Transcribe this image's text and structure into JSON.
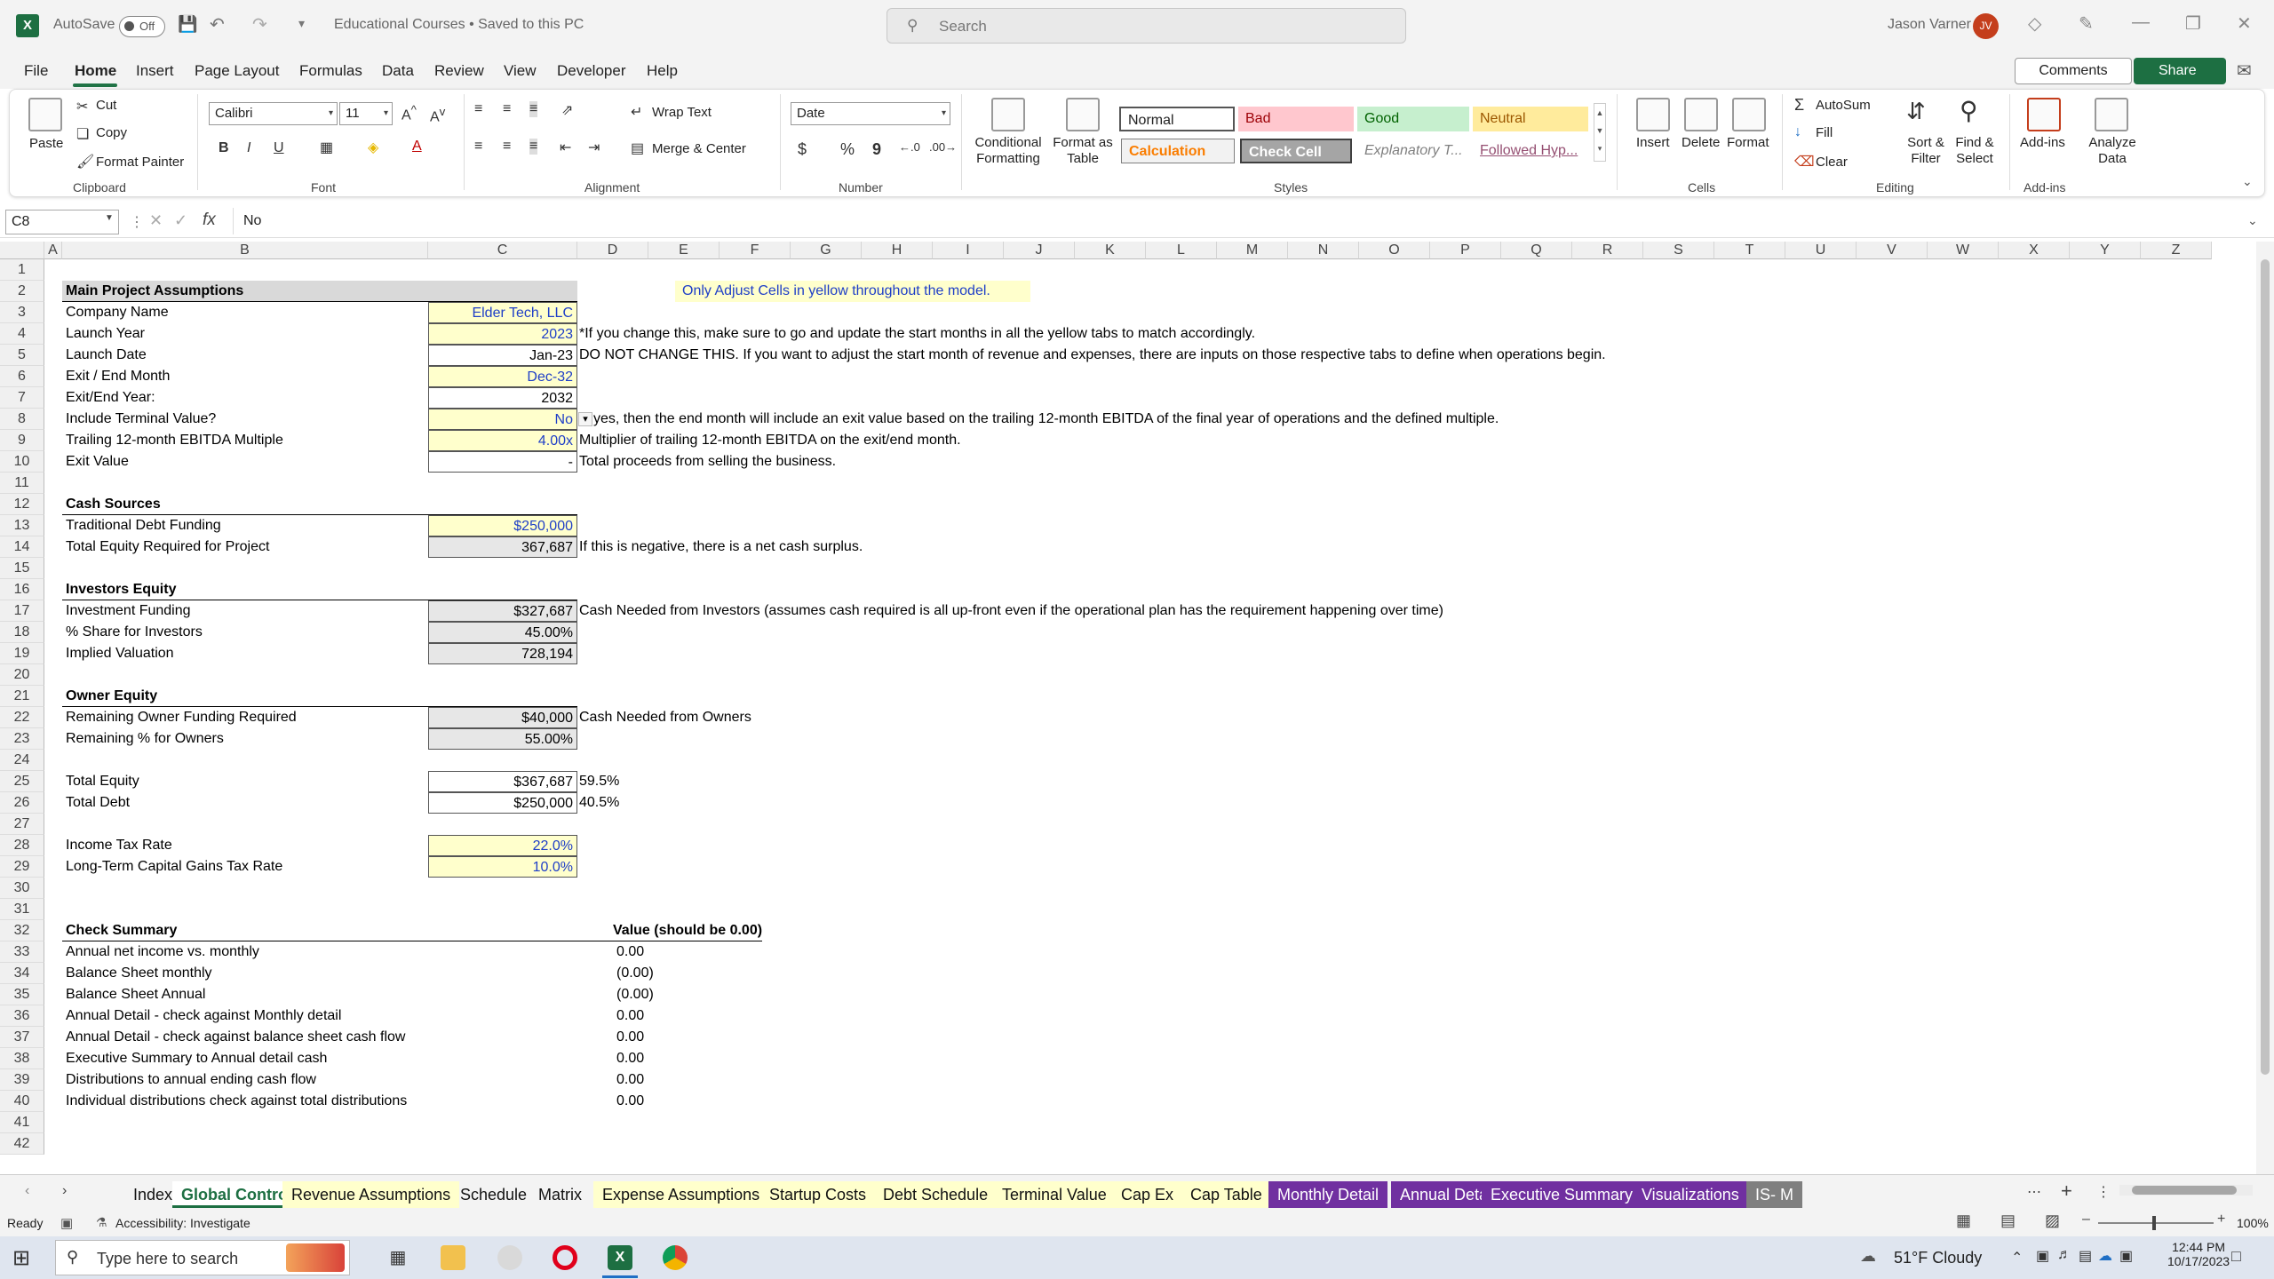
{
  "titlebar": {
    "app_icon": "excel-icon",
    "autosave_label": "AutoSave",
    "autosave_state": "Off",
    "doc_title": "Educational Courses • Saved to this PC",
    "search_placeholder": "Search",
    "user_name": "Jason Varner",
    "user_initials": "JV"
  },
  "menu": {
    "tabs": [
      "File",
      "Home",
      "Insert",
      "Page Layout",
      "Formulas",
      "Data",
      "Review",
      "View",
      "Developer",
      "Help"
    ],
    "active": "Home",
    "comments_label": "Comments",
    "share_label": "Share"
  },
  "ribbon": {
    "clipboard": {
      "paste": "Paste",
      "cut": "Cut",
      "copy": "Copy",
      "format_painter": "Format Painter",
      "label": "Clipboard"
    },
    "font": {
      "name": "Calibri",
      "size": "11",
      "label": "Font",
      "bold": "B",
      "italic": "I",
      "underline": "U"
    },
    "alignment": {
      "wrap_text": "Wrap Text",
      "merge_center": "Merge & Center",
      "label": "Alignment"
    },
    "number": {
      "format": "Date",
      "label": "Number",
      "currency": "$",
      "percent": "%",
      "comma": "9"
    },
    "styles": {
      "conditional_formatting": "Conditional Formatting",
      "format_as_table": "Format as Table",
      "cells": [
        {
          "text": "Normal",
          "bg": "#ffffff",
          "fg": "#000000"
        },
        {
          "text": "Bad",
          "bg": "#ffc7ce",
          "fg": "#9c0006"
        },
        {
          "text": "Good",
          "bg": "#c6efce",
          "fg": "#006100"
        },
        {
          "text": "Neutral",
          "bg": "#ffeb9c",
          "fg": "#9c5700"
        },
        {
          "text": "Calculation",
          "bg": "#f2f2f2",
          "fg": "#fa7d00"
        },
        {
          "text": "Check Cell",
          "bg": "#a5a5a5",
          "fg": "#ffffff"
        },
        {
          "text": "Explanatory T...",
          "bg": "#ffffff",
          "fg": "#7f7f7f"
        },
        {
          "text": "Followed Hyp...",
          "bg": "#ffffff",
          "fg": "#954f72"
        }
      ],
      "label": "Styles"
    },
    "cells": {
      "insert": "Insert",
      "delete": "Delete",
      "format": "Format",
      "label": "Cells"
    },
    "editing": {
      "autosum": "AutoSum",
      "fill": "Fill",
      "clear": "Clear",
      "sort_filter": "Sort & Filter",
      "find_select": "Find & Select",
      "label": "Editing"
    },
    "addins": {
      "addins": "Add-ins",
      "analyze": "Analyze Data",
      "label": "Add-ins"
    }
  },
  "formula_bar": {
    "name_box": "C8",
    "fx": "fx",
    "value": "No"
  },
  "columns": [
    "A",
    "B",
    "C",
    "D",
    "E",
    "F",
    "G",
    "H",
    "I",
    "J",
    "K",
    "L",
    "M",
    "N",
    "O",
    "P",
    "Q",
    "R",
    "S",
    "T",
    "U",
    "V",
    "W",
    "X",
    "Y",
    "Z"
  ],
  "rows": [
    1,
    2,
    3,
    4,
    5,
    6,
    7,
    8,
    9,
    10,
    11,
    12,
    13,
    14,
    15,
    16,
    17,
    18,
    19,
    20,
    21,
    22,
    23,
    24,
    25,
    26,
    27,
    28,
    29,
    30,
    31,
    32,
    33,
    34,
    35,
    36,
    37,
    38,
    39,
    40,
    41,
    42
  ],
  "sheet": {
    "banner": "Only Adjust Cells in yellow throughout the model.",
    "main": {
      "title": "Main Project Assumptions",
      "rows": [
        {
          "label": "Company Name",
          "value": "Elder Tech, LLC",
          "note": ""
        },
        {
          "label": "Launch Year",
          "value": "2023",
          "note": "*If you change this, make sure to go and update the start months in all the yellow tabs to match accordingly."
        },
        {
          "label": "Launch Date",
          "value": "Jan-23",
          "note": "DO NOT CHANGE THIS. If you want to adjust the start month of revenue and expenses, there are inputs on those respective tabs to define when operations begin."
        },
        {
          "label": "Exit / End Month",
          "value": "Dec-32",
          "note": ""
        },
        {
          "label": "Exit/End Year:",
          "value": "2032",
          "note": ""
        },
        {
          "label": "Include Terminal Value?",
          "value": "No",
          "note": "yes, then the end month will include an exit value based on the trailing 12-month EBITDA of the final year of operations and the defined multiple."
        },
        {
          "label": "Trailing 12-month EBITDA Multiple",
          "value": "4.00x",
          "note": "Multiplier of trailing 12-month EBITDA on the exit/end month."
        },
        {
          "label": "Exit Value",
          "value": "-",
          "note": "Total proceeds from selling the business."
        }
      ]
    },
    "cash": {
      "title": "Cash Sources",
      "rows": [
        {
          "label": "Traditional Debt Funding",
          "value": "$250,000",
          "note": ""
        },
        {
          "label": "Total Equity Required for Project",
          "value": "367,687",
          "note": "If this is negative, there is a net cash surplus."
        }
      ]
    },
    "investors": {
      "title": "Investors Equity",
      "rows": [
        {
          "label": "Investment Funding",
          "value": "$327,687",
          "note": "Cash Needed from Investors (assumes cash required is all up-front even if the operational plan has the requirement happening over time)"
        },
        {
          "label": "% Share for Investors",
          "value": "45.00%",
          "note": ""
        },
        {
          "label": "Implied Valuation",
          "value": "728,194",
          "note": ""
        }
      ]
    },
    "owner": {
      "title": "Owner Equity",
      "rows": [
        {
          "label": "Remaining Owner Funding Required",
          "value": "$40,000",
          "note": "Cash Needed from Owners"
        },
        {
          "label": "Remaining % for Owners",
          "value": "55.00%",
          "note": ""
        }
      ]
    },
    "totals": [
      {
        "label": "Total Equity",
        "value": "$367,687",
        "note": "59.5%"
      },
      {
        "label": "Total Debt",
        "value": "$250,000",
        "note": "40.5%"
      }
    ],
    "tax": [
      {
        "label": "Income Tax Rate",
        "value": "22.0%"
      },
      {
        "label": "Long-Term Capital Gains Tax Rate",
        "value": "10.0%"
      }
    ],
    "checks": {
      "title": "Check Summary",
      "value_header": "Value (should be 0.00)",
      "rows": [
        {
          "label": "Annual net income vs. monthly",
          "value": "0.00"
        },
        {
          "label": "Balance Sheet monthly",
          "value": "(0.00)"
        },
        {
          "label": "Balance Sheet Annual",
          "value": "(0.00)"
        },
        {
          "label": "Annual Detail - check against Monthly detail",
          "value": "0.00"
        },
        {
          "label": "Annual Detail - check against balance sheet cash flow",
          "value": "0.00"
        },
        {
          "label": "Executive Summary to Annual detail cash",
          "value": "0.00"
        },
        {
          "label": "Distributions to annual ending cash flow",
          "value": "0.00"
        },
        {
          "label": "Individual distributions check against total distributions",
          "value": "0.00"
        }
      ]
    }
  },
  "sheet_tabs": [
    {
      "name": "Index",
      "style": "plain"
    },
    {
      "name": "Global Control",
      "style": "active"
    },
    {
      "name": "Revenue Assumptions",
      "style": "yel"
    },
    {
      "name": "Schedule",
      "style": "plain"
    },
    {
      "name": "Matrix",
      "style": "plain"
    },
    {
      "name": "Expense Assumptions",
      "style": "yel"
    },
    {
      "name": "Startup Costs",
      "style": "yel"
    },
    {
      "name": "Debt Schedule",
      "style": "yel"
    },
    {
      "name": "Terminal Value",
      "style": "yel"
    },
    {
      "name": "Cap Ex",
      "style": "yel"
    },
    {
      "name": "Cap Table",
      "style": "yel"
    },
    {
      "name": "Monthly Detail",
      "style": "pur"
    },
    {
      "name": "Annual Detail",
      "style": "pur"
    },
    {
      "name": "Executive Summary",
      "style": "pur"
    },
    {
      "name": "Visualizations",
      "style": "pur"
    },
    {
      "name": "IS- M",
      "style": "gry"
    }
  ],
  "status": {
    "ready": "Ready",
    "accessibility": "Accessibility: Investigate",
    "zoom": "100%"
  },
  "taskbar": {
    "search_placeholder": "Type here to search",
    "weather": "51°F  Cloudy",
    "time": "12:44 PM",
    "date": "10/17/2023"
  }
}
